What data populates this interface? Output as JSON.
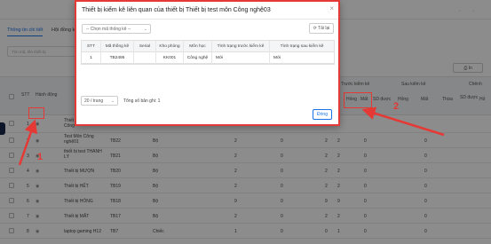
{
  "page": {
    "tabs": [
      {
        "label": "Thông tin chi tiết",
        "active": true
      },
      {
        "label": "Hội đồng k",
        "active": false
      }
    ],
    "search_placeholder": "Tìm mã, tên thiết bị",
    "print_label": "In",
    "table": {
      "headers": {
        "stt": "STT",
        "action": "Hành động",
        "code": "Mã",
        "unit": "Đơn vị",
        "group_before": "Trước kiểm kê",
        "group_after": "Sau kiểm kê",
        "group_diff": "Chênh",
        "hong": "Hỏng",
        "mat": "Mất",
        "sd_duoc": "SD được",
        "hong2": "Hỏng",
        "mat2": "Mất",
        "thua": "Thừa",
        "sd_duoc2": "SD được",
        "hong3": "Hỏ"
      },
      "rows": [
        {
          "stt": "1",
          "name": "Thiết bị test môn Công",
          "code": "",
          "unit": "",
          "q1": "",
          "q2": "",
          "q3": "",
          "q4": "",
          "q5": "",
          "q6": ""
        },
        {
          "stt": "2",
          "name": "Test Môn Công nghệ01",
          "code": "TB22",
          "unit": "Bộ",
          "q1": "2",
          "q2": "0",
          "q3": "2",
          "q4": "2",
          "q5": "0",
          "q6": "0"
        },
        {
          "stt": "3",
          "name": "thiết bị test THANH LÝ",
          "code": "TB21",
          "unit": "Bộ",
          "q1": "2",
          "q2": "0",
          "q3": "2",
          "q4": "2",
          "q5": "0",
          "q6": "0"
        },
        {
          "stt": "4",
          "name": "Thiết bị MƯỢN",
          "code": "TB20",
          "unit": "Bộ",
          "q1": "2",
          "q2": "0",
          "q3": "2",
          "q4": "2",
          "q5": "0",
          "q6": "0"
        },
        {
          "stt": "5",
          "name": "Thiết bị HẾT",
          "code": "TB19",
          "unit": "Bộ",
          "q1": "2",
          "q2": "0",
          "q3": "2",
          "q4": "2",
          "q5": "0",
          "q6": "0"
        },
        {
          "stt": "6",
          "name": "Thiết bị HỎNG",
          "code": "TB18",
          "unit": "Bộ",
          "q1": "9",
          "q2": "0",
          "q3": "9",
          "q4": "9",
          "q5": "0",
          "q6": "0"
        },
        {
          "stt": "7",
          "name": "Thiết bị MẤT",
          "code": "TB17",
          "unit": "Bộ",
          "q1": "2",
          "q2": "0",
          "q3": "2",
          "q4": "2",
          "q5": "0",
          "q6": "0"
        },
        {
          "stt": "8",
          "name": "laptop gaming H12",
          "code": "TB7",
          "unit": "Chiếc",
          "q1": "1",
          "q2": "0",
          "q3": "0",
          "q4": "1",
          "q5": "0",
          "q6": "0"
        }
      ]
    }
  },
  "modal": {
    "title": "Thiết bị kiểm kê liên quan của thiết bị Thiết bị test môn Công nghệ03",
    "close_glyph": "×",
    "select_placeholder": "-- Chọn mã thống kê --",
    "select_arrow": "⌄",
    "reload_label": "⟳ Tải lại",
    "headers": [
      "STT",
      "Mã thống kê",
      "Serial",
      "Kho phòng",
      "Môn học",
      "Tình trạng trước kiểm kê",
      "Tình trạng sau kiểm kê"
    ],
    "row": [
      "1",
      "TB2495",
      "",
      "KK001",
      "Công nghệ",
      "Mới",
      "Mới"
    ],
    "page_size": "20 / trang",
    "page_size_arrow": "⌄",
    "total": "Tổng số bản ghi: 1",
    "close_button": "Đóng"
  },
  "annotations": {
    "num1": "1",
    "num2": "2",
    "color": "#e53935"
  }
}
